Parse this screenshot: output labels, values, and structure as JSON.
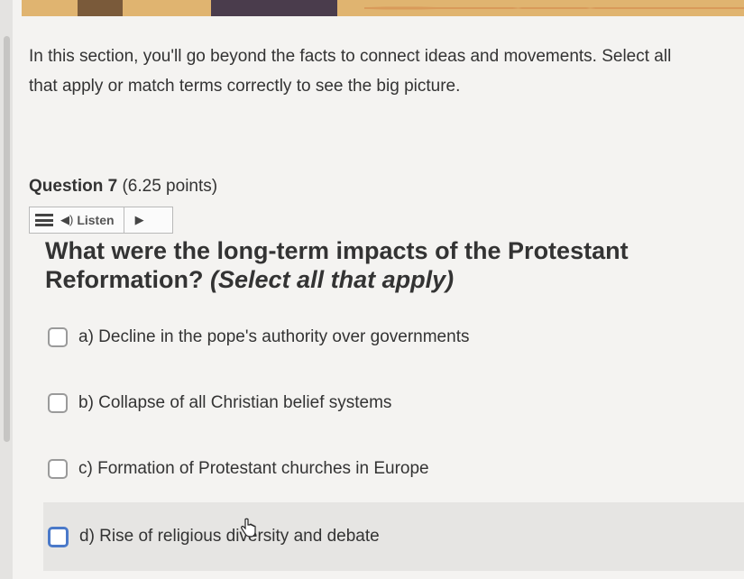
{
  "intro": {
    "line1": "In this section, you'll go beyond the facts to connect ideas and movements. Select all",
    "line2": "that apply or match terms correctly to see the big picture."
  },
  "question_header": {
    "number": "Question 7",
    "points": "(6.25 points)"
  },
  "listen_bar": {
    "label": "Listen"
  },
  "question": {
    "text": "What were the long-term impacts of the Protestant Reformation?",
    "instruction": "(Select all that apply)"
  },
  "options": [
    {
      "label": "a) Decline in the pope's authority over governments",
      "checked": false
    },
    {
      "label": "b) Collapse of all Christian belief systems",
      "checked": false
    },
    {
      "label": "c) Formation of Protestant churches in Europe",
      "checked": false
    },
    {
      "label": "d) Rise of religious diversity and debate",
      "checked": false
    }
  ],
  "colors": {
    "accent": "#4a79c9",
    "background": "#f4f3f1",
    "hover_row": "#e6e5e3"
  },
  "icons": [
    "menu-icon",
    "speaker-icon",
    "play-icon",
    "hand-cursor-icon"
  ]
}
